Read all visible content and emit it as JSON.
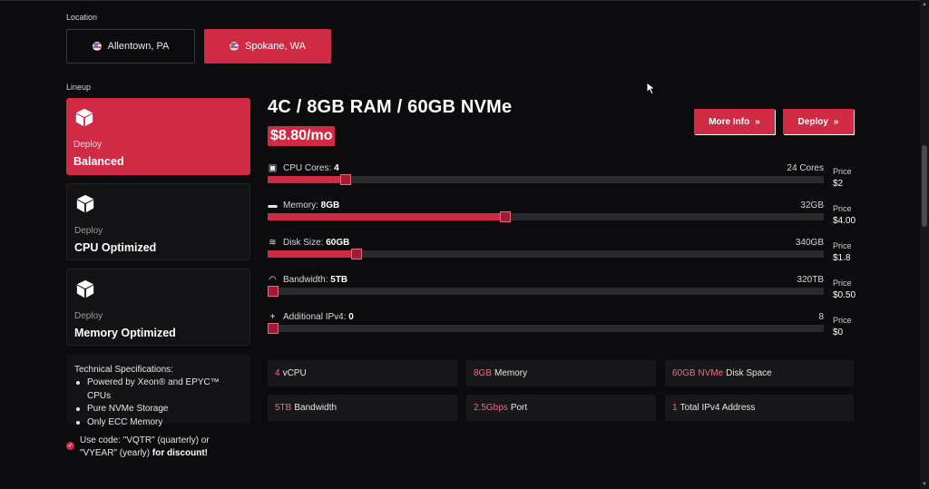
{
  "location": {
    "heading": "Location",
    "options": [
      {
        "label": "Allentown, PA",
        "state": "inactive"
      },
      {
        "label": "Spokane, WA",
        "state": "active"
      }
    ]
  },
  "lineup": {
    "heading": "Lineup",
    "plans": [
      {
        "deploy_label": "Deploy",
        "name": "Balanced",
        "state": "active"
      },
      {
        "deploy_label": "Deploy",
        "name": "CPU Optimized",
        "state": "inactive"
      },
      {
        "deploy_label": "Deploy",
        "name": "Memory Optimized",
        "state": "inactive"
      }
    ]
  },
  "specs": {
    "heading": "Technical Specifications:",
    "items": [
      "Powered by Xeon® and EPYC™ CPUs",
      "Pure NVMe Storage",
      "Only ECC Memory"
    ]
  },
  "promo": {
    "text": "Use code: \"VQTR\" (quarterly) or \"VYEAR\" (yearly) ",
    "bold": "for discount!"
  },
  "config": {
    "title": "4C / 8GB RAM / 60GB NVMe",
    "price": "$8.80/mo",
    "more_info_label": "More Info",
    "deploy_label": "Deploy"
  },
  "sliders": [
    {
      "icon": "cpu-icon",
      "label": "CPU Cores: ",
      "value": "4",
      "max_label": "24 Cores",
      "price_label": "Price",
      "price": "$2",
      "fraction": 0.13
    },
    {
      "icon": "memory-icon",
      "label": "Memory: ",
      "value": "8GB",
      "max_label": "32GB",
      "price_label": "Price",
      "price": "$4.00",
      "fraction": 0.417
    },
    {
      "icon": "disk-icon",
      "label": "Disk Size: ",
      "value": "60GB",
      "max_label": "340GB",
      "price_label": "Price",
      "price": "$1.8",
      "fraction": 0.15
    },
    {
      "icon": "wifi-icon",
      "label": "Bandwidth: ",
      "value": "5TB",
      "max_label": "320TB",
      "price_label": "Price",
      "price": "$0.50",
      "fraction": 0.0
    },
    {
      "icon": "plus-icon",
      "label": "Additional IPv4: ",
      "value": "0",
      "max_label": "8",
      "price_label": "Price",
      "price": "$0",
      "fraction": 0.0
    }
  ],
  "features": [
    {
      "highlight": "4",
      "text": "vCPU"
    },
    {
      "highlight": "8GB",
      "text": "Memory"
    },
    {
      "highlight": "60GB NVMe",
      "text": "Disk Space"
    },
    {
      "highlight": "5TB",
      "text": "Bandwidth"
    },
    {
      "highlight": "2.5Gbps",
      "text": "Port"
    },
    {
      "highlight": "1",
      "text": "Total IPv4 Address"
    }
  ],
  "colors": {
    "accent": "#d02a45",
    "background": "#0c0c0f",
    "card": "#131316"
  }
}
